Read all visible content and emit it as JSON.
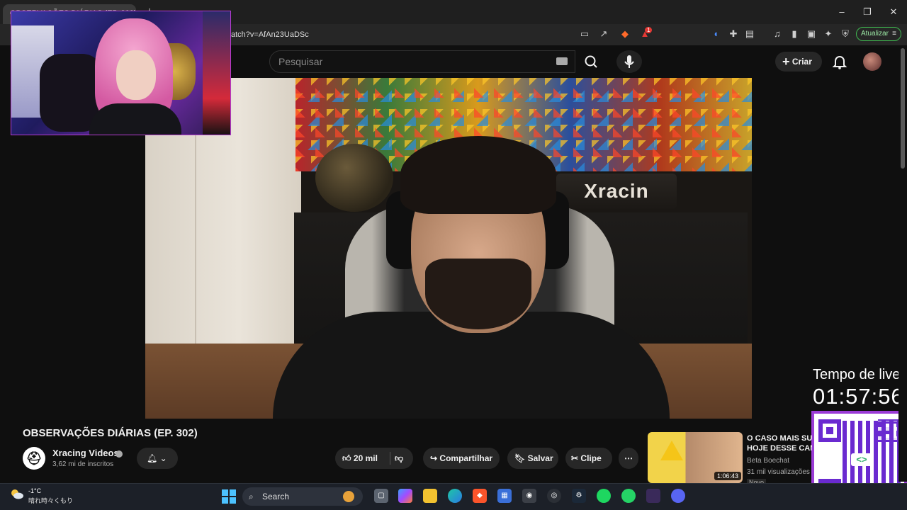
{
  "browser": {
    "tab_title": "OBSERVAÇÕES DIÁRIAS (EP. 302)",
    "url": "atch?v=AfAn23UaDSc",
    "update_label": "Atualizar",
    "brave_badge": "1",
    "window_controls": {
      "minimize": "–",
      "restore": "❐",
      "close": "✕"
    }
  },
  "youtube": {
    "search_placeholder": "Pesquisar",
    "create_label": "Criar",
    "video": {
      "title": "OBSERVAÇÕES DIÁRIAS (EP. 302)",
      "brand_sign": "Xracin"
    },
    "channel": {
      "name": "Xracing Videos",
      "subscribers": "3,62 mi de inscritos"
    },
    "actions": {
      "likes": "20 mil",
      "share": "Compartilhar",
      "save": "Salvar",
      "clip": "Clipe",
      "more": "⋯"
    },
    "recommendation": {
      "title_line1": "O CASO MAIS SUF",
      "title_line2": "HOJE DESSE CAN",
      "channel": "Beta Boechat",
      "views": "31 mil visualizações",
      "badge": "Novo",
      "duration": "1:06:43"
    }
  },
  "stream_overlay": {
    "timer_label": "Tempo de live:",
    "timer_value": "01:57:56"
  },
  "taskbar": {
    "weather_temp": "-1°C",
    "weather_desc": "晴れ時々くもり",
    "search_label": "Search"
  },
  "colors": {
    "update_border": "#3fb950",
    "overlay_border": "#9b3bd6",
    "qr_color": "#6a2ad0"
  }
}
